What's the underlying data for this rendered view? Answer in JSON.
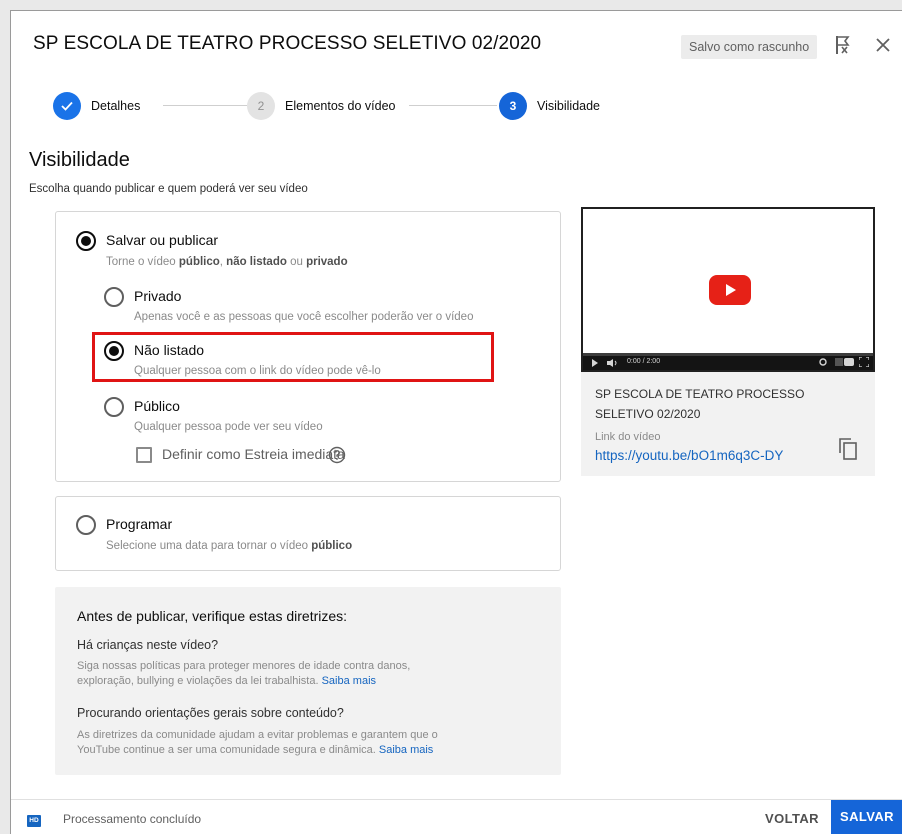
{
  "header": {
    "title": "SP ESCOLA DE TEATRO PROCESSO SELETIVO 02/2020",
    "draft_badge": "Salvo como rascunho",
    "feedback_icon": "feedback-flag-icon",
    "close_icon": "close-icon"
  },
  "stepper": {
    "steps": [
      {
        "number": "✓",
        "label": "Detalhes",
        "state": "done"
      },
      {
        "number": "2",
        "label": "Elementos do vídeo",
        "state": "todo"
      },
      {
        "number": "3",
        "label": "Visibilidade",
        "state": "active"
      }
    ]
  },
  "visibility": {
    "title": "Visibilidade",
    "subtitle": "Escolha quando publicar e quem poderá ver seu vídeo",
    "save_publish": {
      "label": "Salvar ou publicar",
      "desc_prefix": "Torne o vídeo ",
      "desc_b1": "público",
      "desc_mid1": ", ",
      "desc_b2": "não listado",
      "desc_mid2": " ou ",
      "desc_b3": "privado",
      "selected": true
    },
    "options": [
      {
        "label": "Privado",
        "desc": "Apenas você e as pessoas que você escolher poderão ver o vídeo",
        "selected": false
      },
      {
        "label": "Não listado",
        "desc": "Qualquer pessoa com o link do vídeo pode vê-lo",
        "selected": true
      },
      {
        "label": "Público",
        "desc": "Qualquer pessoa pode ver seu vídeo",
        "selected": false
      }
    ],
    "premiere": {
      "label": "Definir como Estreia imediata",
      "checked": false
    },
    "schedule": {
      "label": "Programar",
      "desc_prefix": "Selecione uma data para tornar o vídeo ",
      "desc_bold": "público",
      "selected": false
    }
  },
  "guidelines": {
    "title": "Antes de publicar, verifique estas diretrizes:",
    "q1": "Há crianças neste vídeo?",
    "t1_line1": "Siga nossas políticas para proteger menores de idade contra danos,",
    "t1_line2": "exploração, bullying e violações da lei trabalhista. ",
    "t1_link": "Saiba mais",
    "q2": "Procurando orientações gerais sobre conteúdo?",
    "t2_line1": "As diretrizes da comunidade ajudam a evitar problemas e garantem que o",
    "t2_line2": "YouTube continue a ser uma comunidade segura e dinâmica. ",
    "t2_link": "Saiba mais"
  },
  "preview": {
    "player_time": "0:00 / 2:00",
    "video_title": "SP ESCOLA DE TEATRO PROCESSO SELETIVO 02/2020",
    "link_label": "Link do vídeo",
    "link_url": "https://youtu.be/bO1m6q3C-DY"
  },
  "footer": {
    "hd_badge": "HD",
    "status": "Processamento concluído",
    "back": "VOLTAR",
    "save": "SALVAR"
  },
  "colors": {
    "accent": "#1565d8",
    "highlight": "#e01414",
    "youtube_red": "#e62117"
  }
}
